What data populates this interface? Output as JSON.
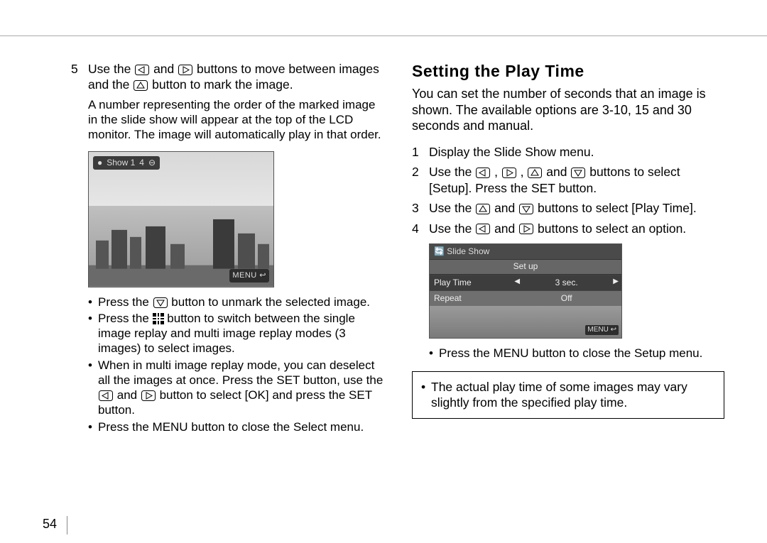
{
  "page_number": "54",
  "left": {
    "step5_num": "5",
    "step5_a": "Use the ",
    "step5_b": " and ",
    "step5_c": " buttons to move between images and the ",
    "step5_d": " button to mark the image.",
    "step5_sub": "A number representing the order of the marked image in the slide show will appear at the top of the LCD monitor. The image will automatically play in that order.",
    "lcd_topbar_a": "Show 1",
    "lcd_topbar_b": "4",
    "lcd_menu": "MENU ↩",
    "b1a": "Press the ",
    "b1b": " button to unmark the selected image.",
    "b2a": "Press the ",
    "b2b": " button to switch between the single image replay and multi image replay modes (3 images) to select images.",
    "b3a": "When in multi image replay mode, you can deselect all the images at once. Press the SET button, use the ",
    "b3b": " and ",
    "b3c": " button to select [OK] and press the SET button.",
    "b4": "Press the MENU button to close the Select menu."
  },
  "right": {
    "heading": "Setting the Play Time",
    "intro": "You can set the number of seconds that an image is shown. The available options are 3-10, 15 and 30 seconds and manual.",
    "s1_num": "1",
    "s1": "Display the Slide Show menu.",
    "s2_num": "2",
    "s2_a": "Use the ",
    "s2_b": ", ",
    "s2_c": ", ",
    "s2_d": " and ",
    "s2_e": " buttons to select [Setup]. Press the SET button.",
    "s3_num": "3",
    "s3_a": "Use the ",
    "s3_b": " and ",
    "s3_c": " buttons to select [Play Time].",
    "s4_num": "4",
    "s4_a": "Use the ",
    "s4_b": " and ",
    "s4_c": " buttons to select an option.",
    "lcd2_header": "Slide Show",
    "lcd2_tab": "Set up",
    "lcd2_r1k": "Play Time",
    "lcd2_r1v": "3 sec.",
    "lcd2_r2k": "Repeat",
    "lcd2_r2v": "Off",
    "lcd2_menu": "MENU ↩",
    "bullet": "Press the MENU button to close the Setup menu.",
    "note": "The actual play time of some images may vary slightly from the specified play time."
  }
}
